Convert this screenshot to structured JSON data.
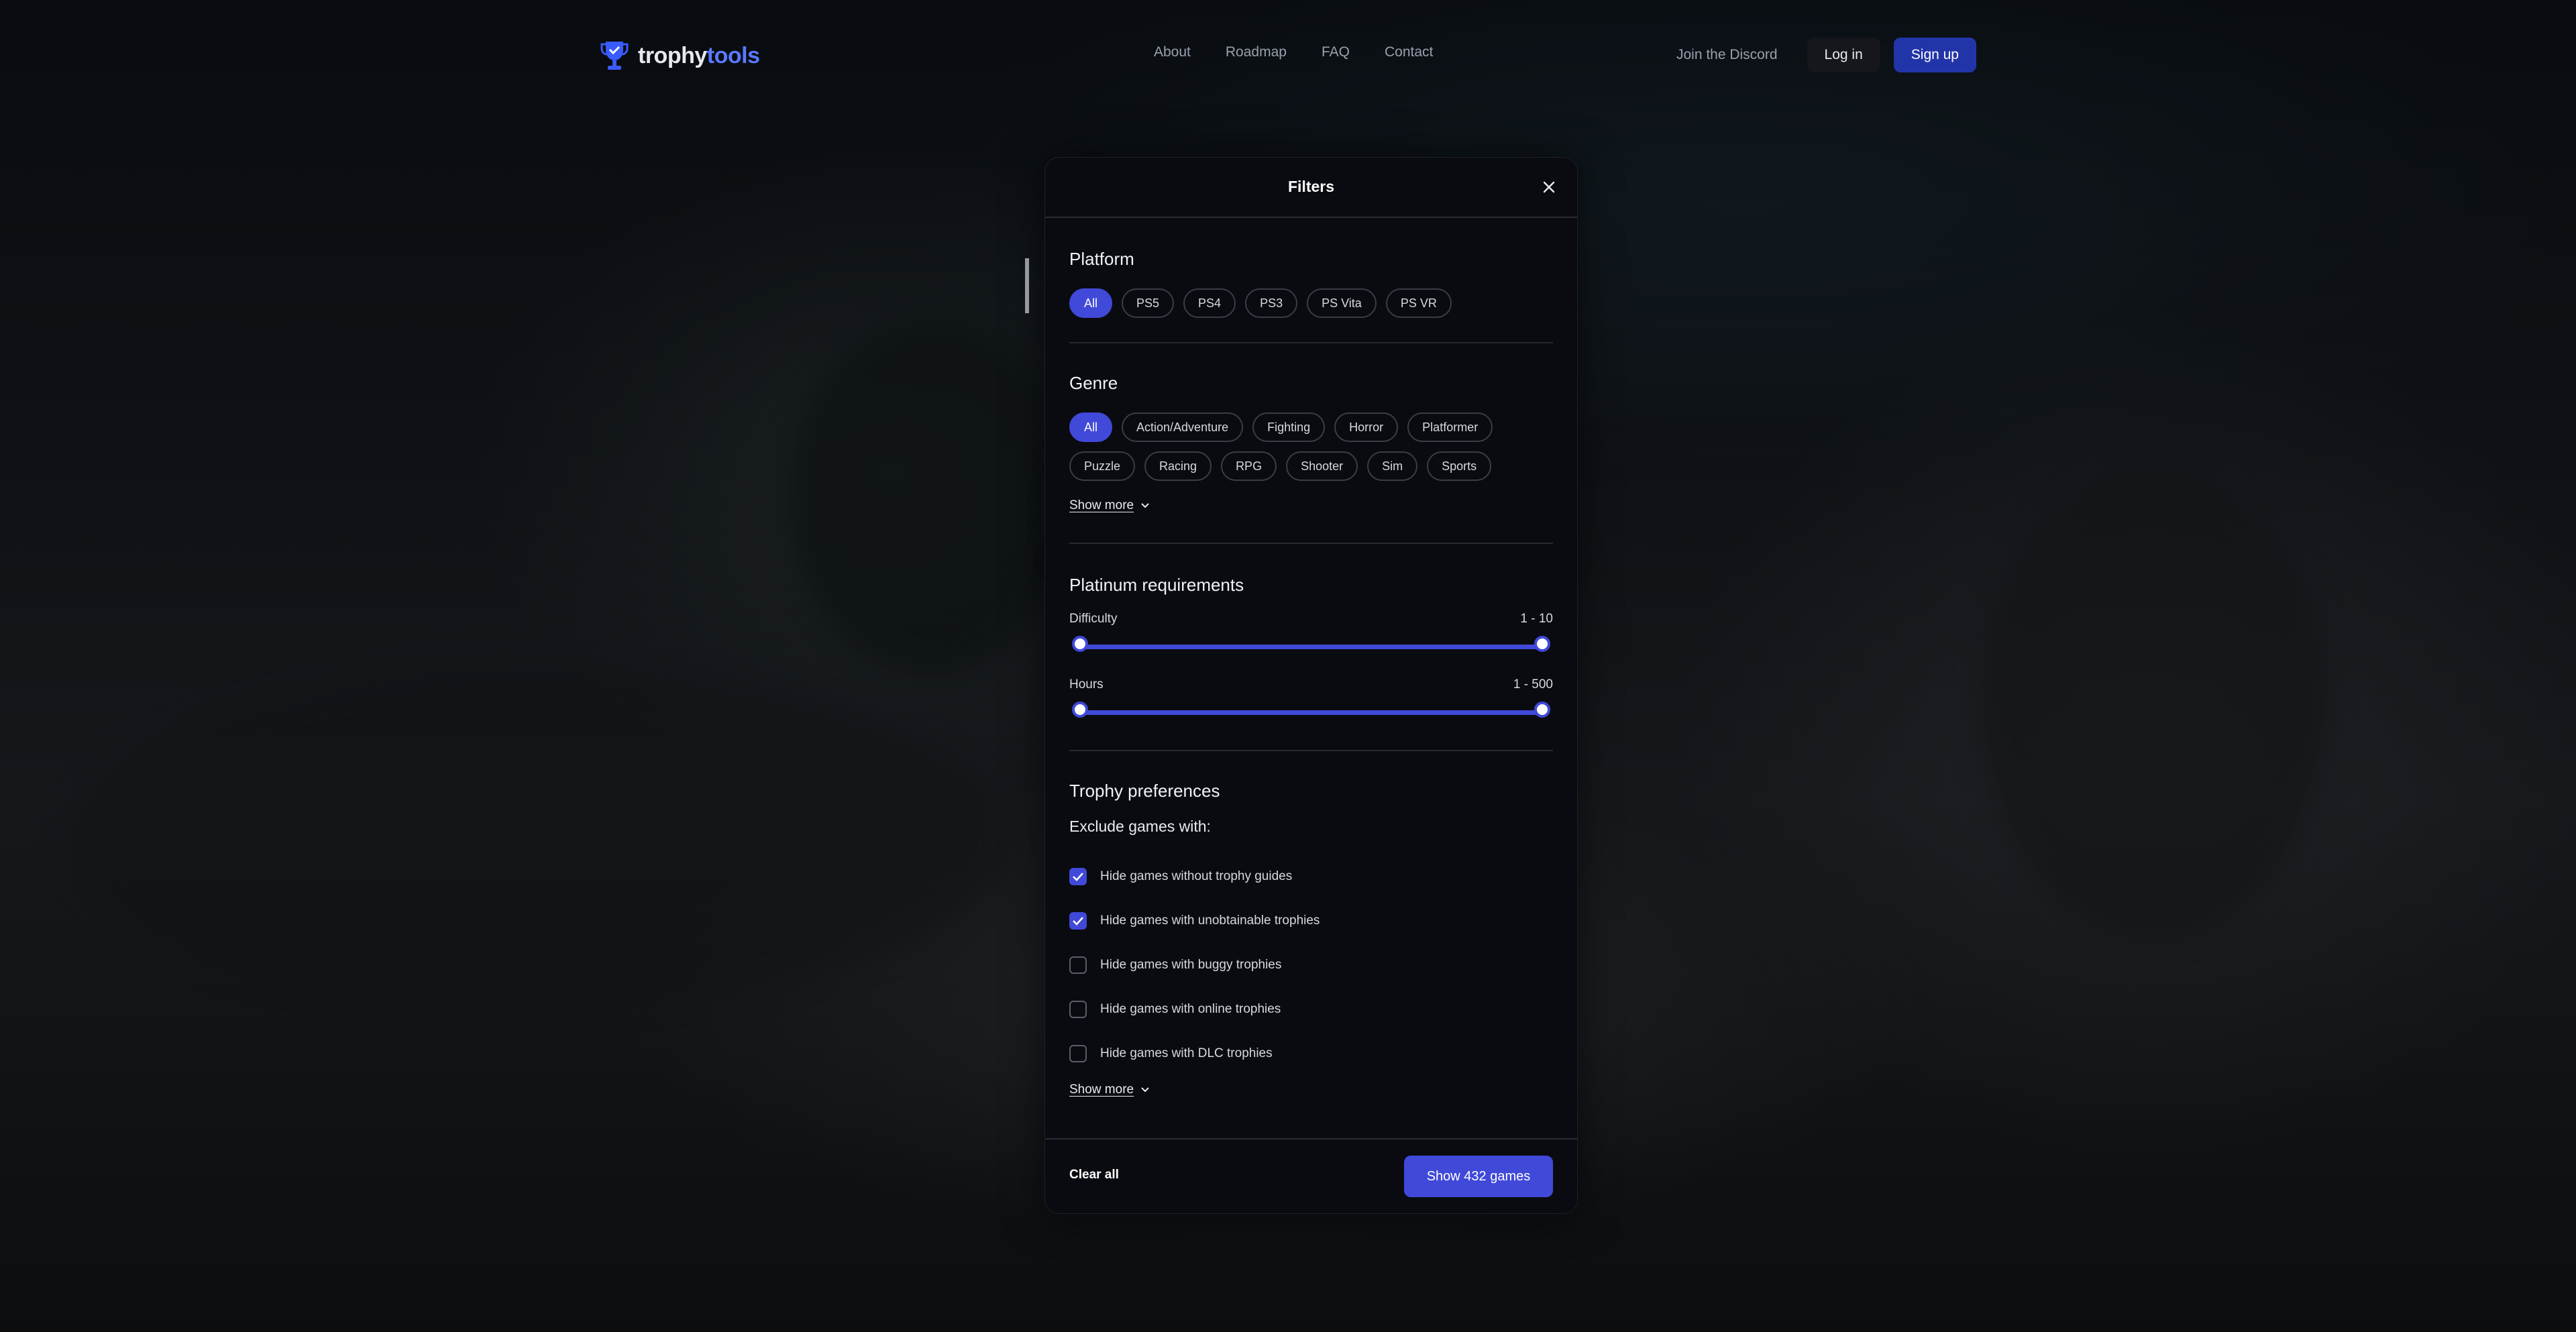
{
  "header": {
    "logo": {
      "part1": "trophy",
      "part2": "tools"
    },
    "nav": [
      "About",
      "Roadmap",
      "FAQ",
      "Contact"
    ],
    "discord": "Join the Discord",
    "login": "Log in",
    "signup": "Sign up"
  },
  "modal": {
    "title": "Filters",
    "platform": {
      "title": "Platform",
      "options": [
        {
          "label": "All",
          "active": true
        },
        {
          "label": "PS5",
          "active": false
        },
        {
          "label": "PS4",
          "active": false
        },
        {
          "label": "PS3",
          "active": false
        },
        {
          "label": "PS Vita",
          "active": false
        },
        {
          "label": "PS VR",
          "active": false
        }
      ]
    },
    "genre": {
      "title": "Genre",
      "options": [
        {
          "label": "All",
          "active": true
        },
        {
          "label": "Action/Adventure",
          "active": false
        },
        {
          "label": "Fighting",
          "active": false
        },
        {
          "label": "Horror",
          "active": false
        },
        {
          "label": "Platformer",
          "active": false
        },
        {
          "label": "Puzzle",
          "active": false
        },
        {
          "label": "Racing",
          "active": false
        },
        {
          "label": "RPG",
          "active": false
        },
        {
          "label": "Shooter",
          "active": false
        },
        {
          "label": "Sim",
          "active": false
        },
        {
          "label": "Sports",
          "active": false
        }
      ],
      "show_more": "Show more"
    },
    "platinum": {
      "title": "Platinum requirements",
      "difficulty": {
        "label": "Difficulty",
        "range_text": "1 - 10",
        "min": 1,
        "max": 10
      },
      "hours": {
        "label": "Hours",
        "range_text": "1 - 500",
        "min": 1,
        "max": 500
      }
    },
    "trophy": {
      "title": "Trophy preferences",
      "exclude_label": "Exclude games with:",
      "options": [
        {
          "label": "Hide games without trophy guides",
          "checked": true
        },
        {
          "label": "Hide games with unobtainable trophies",
          "checked": true
        },
        {
          "label": "Hide games with buggy trophies",
          "checked": false
        },
        {
          "label": "Hide games with online trophies",
          "checked": false
        },
        {
          "label": "Hide games with DLC trophies",
          "checked": false
        }
      ],
      "show_more": "Show more"
    },
    "footer": {
      "clear": "Clear all",
      "show": "Show 432 games"
    }
  },
  "colors": {
    "accent": "#4049d8",
    "signup": "#2235a8",
    "brand_blue": "#5a78ff"
  }
}
